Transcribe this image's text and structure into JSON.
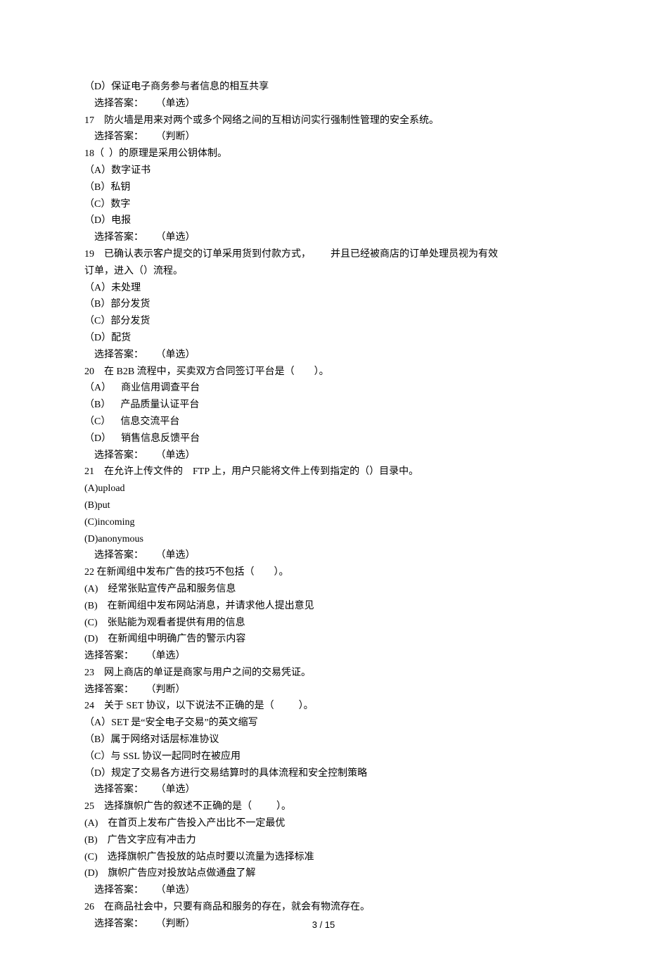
{
  "lines": [
    "（D）保证电子商务参与者信息的相互共享",
    "    选择答案：     （单选）",
    "17    防火墙是用来对两个或多个网络之间的互相访问实行强制性管理的安全系统。",
    "    选择答案：     （判断）",
    "18（  ）的原理是采用公钥体制。",
    "（A）数字证书",
    "（B）私钥",
    "（C）数字",
    "（D）电报",
    "    选择答案：     （单选）",
    "19    已确认表示客户提交的订单采用货到付款方式，        并且已经被商店的订单处理员视为有效",
    "订单，进入（）流程。",
    "（A）未处理",
    "（B）部分发货",
    "（C）部分发货",
    "（D）配货",
    "    选择答案：     （单选）",
    "20    在 B2B 流程中，买卖双方合同签订平台是（        ）。",
    "（A）    商业信用调查平台",
    "（B）    产品质量认证平台",
    "（C）    信息交流平台",
    "（D）    销售信息反馈平台",
    "    选择答案：     （单选）",
    "21    在允许上传文件的    FTP 上，用户只能将文件上传到指定的（）目录中。",
    "(A)upload",
    "(B)put",
    "(C)incoming",
    "(D)anonymous",
    "    选择答案：     （单选）",
    "22 在新闻组中发布广告的技巧不包括（        ）。",
    "(A)    经常张贴宣传产品和服务信息",
    "(B)    在新闻组中发布网站消息，并请求他人提出意见",
    "(C)    张贴能为观看者提供有用的信息",
    "(D)    在新闻组中明确广告的警示内容",
    "选择答案：     （单选）",
    "23    网上商店的单证是商家与用户之间的交易凭证。",
    "选择答案：     （判断）",
    "24    关于 SET 协议，以下说法不正确的是（          ）。",
    "（A）SET 是“安全电子交易”的英文缩写",
    "（B）属于网络对话层标准协议",
    "（C）与 SSL 协议一起同时在被应用",
    "（D）规定了交易各方进行交易结算时的具体流程和安全控制策略",
    "    选择答案：     （单选）",
    "25    选择旗帜广告的叙述不正确的是（          ）。",
    "(A)    在首页上发布广告投入产出比不一定最优",
    "(B)    广告文字应有冲击力",
    "(C)    选择旗帜广告投放的站点时要以流量为选择标准",
    "(D)    旗帜广告应对投放站点做通盘了解",
    "    选择答案：     （单选）",
    "26    在商品社会中，只要有商品和服务的存在，就会有物流存在。",
    "    选择答案：     （判断）"
  ],
  "footer": "3  /  15"
}
